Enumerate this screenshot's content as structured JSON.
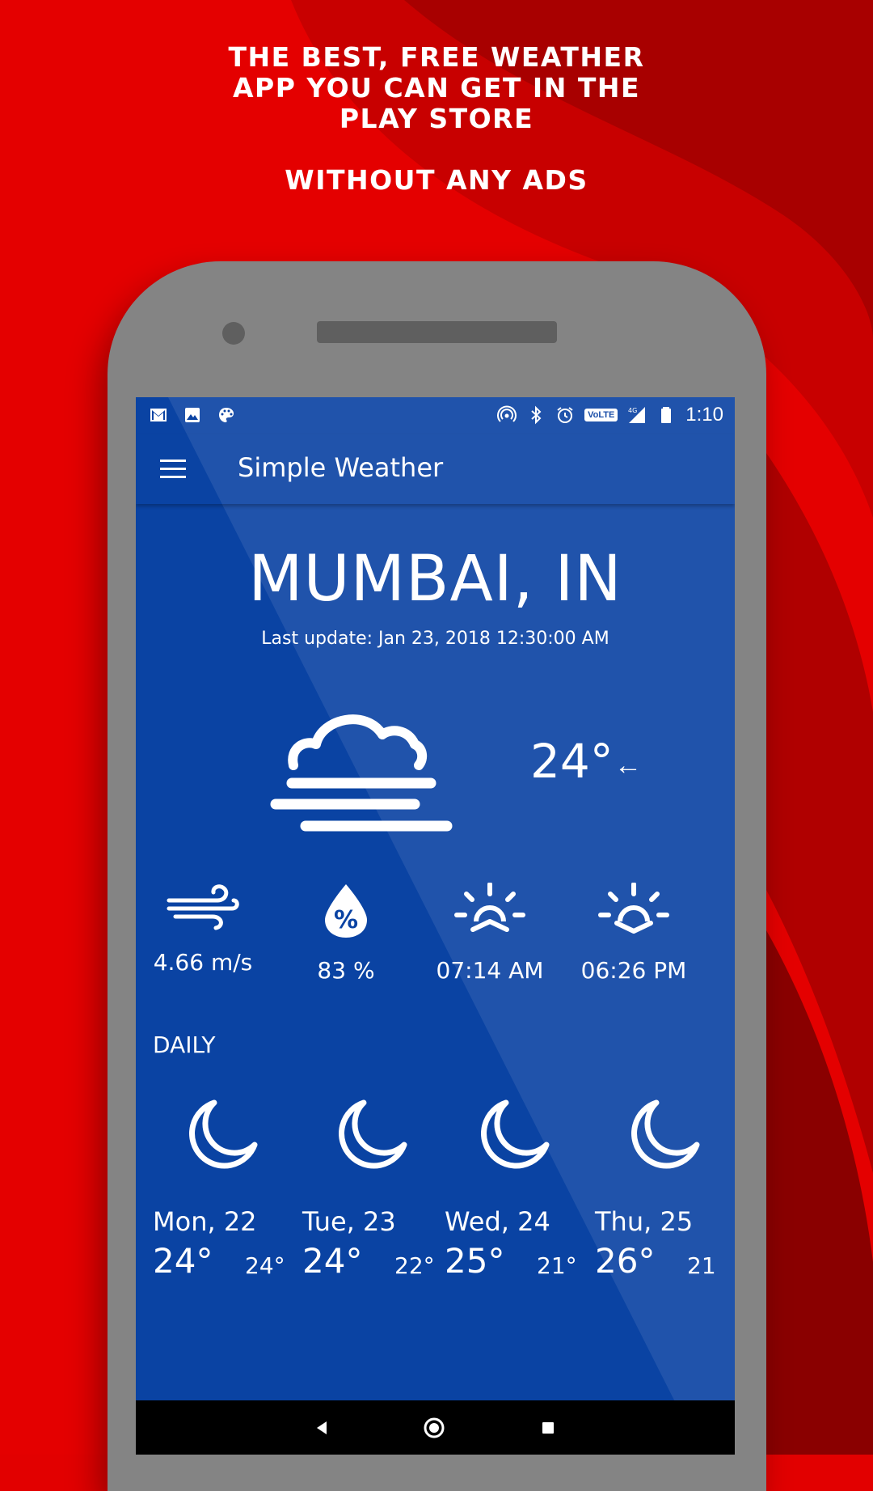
{
  "promo": {
    "line1": "THE BEST, FREE WEATHER",
    "line2": "APP YOU CAN GET IN THE",
    "line3": "PLAY STORE",
    "line4": "WITHOUT ANY ADS"
  },
  "statusbar": {
    "time": "1:10",
    "volte": "VoLTE",
    "network": "4G",
    "left_icons": [
      "gmail-icon",
      "image-icon",
      "palette-icon"
    ],
    "right_icons": [
      "hotspot-icon",
      "bluetooth-icon",
      "alarm-icon",
      "volte-icon",
      "signal-icon",
      "battery-icon"
    ]
  },
  "toolbar": {
    "title": "Simple Weather",
    "menu_icon": "hamburger-menu-icon"
  },
  "current": {
    "location": "MUMBAI, IN",
    "last_update": "Last update: Jan 23, 2018 12:30:00 AM",
    "condition_icon": "fog-cloud-icon",
    "temperature": "24°",
    "wind_direction_arrow": "←"
  },
  "stats": [
    {
      "icon": "wind-icon",
      "value": "4.66 m/s"
    },
    {
      "icon": "humidity-icon",
      "value": "83 %"
    },
    {
      "icon": "sunrise-icon",
      "value": "07:14 AM"
    },
    {
      "icon": "sunset-icon",
      "value": "06:26 PM"
    }
  ],
  "daily_label": "DAILY",
  "daily": [
    {
      "day": "Mon, 22",
      "high": "24°",
      "low": "24°",
      "icon": "moon-icon"
    },
    {
      "day": "Tue, 23",
      "high": "24°",
      "low": "22°",
      "icon": "moon-icon"
    },
    {
      "day": "Wed, 24",
      "high": "25°",
      "low": "21°",
      "icon": "moon-icon"
    },
    {
      "day": "Thu, 25",
      "high": "26°",
      "low": "21",
      "icon": "moon-icon"
    }
  ],
  "navbar": {
    "buttons": [
      "back-icon",
      "home-icon",
      "recents-icon"
    ]
  },
  "colors": {
    "background_red": "#e20000",
    "screen_blue": "#0a43a3",
    "phone_gray": "#848484",
    "text": "#ffffff"
  }
}
